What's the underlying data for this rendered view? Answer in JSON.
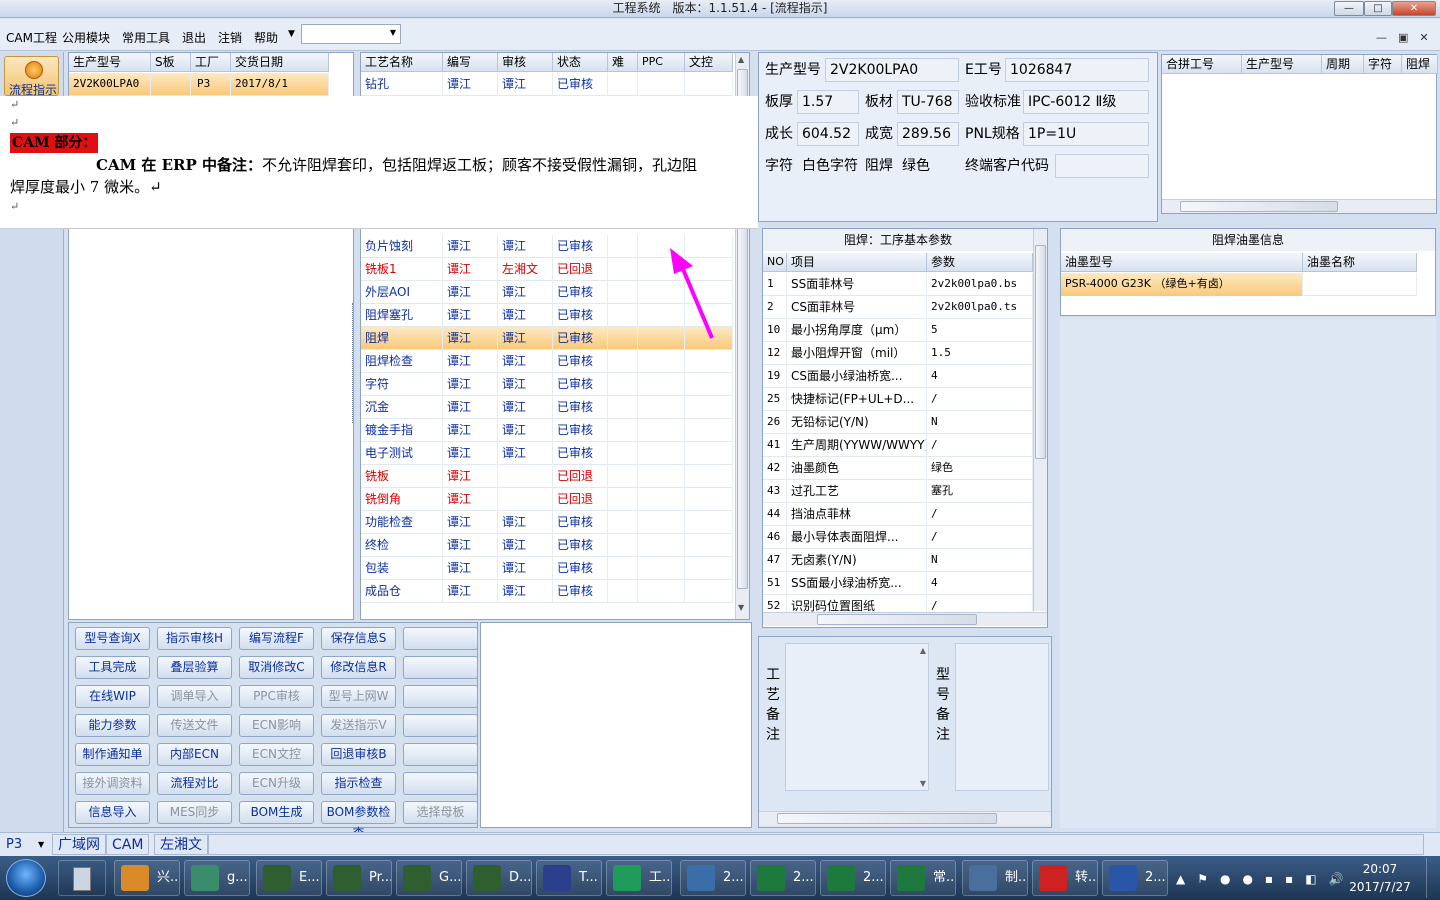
{
  "window": {
    "title": "工程系统　版本：1.1.51.4 - [流程指示]"
  },
  "menu": [
    "CAM工程",
    "公用模块",
    "常用工具",
    "退出",
    "注销",
    "帮助"
  ],
  "nav": {
    "label": "流程指示"
  },
  "order": {
    "headers": [
      "生产型号",
      "S板",
      "工厂",
      "交货日期"
    ],
    "row": [
      "2V2K00LPA0",
      "",
      "P3",
      "2017/8/1"
    ]
  },
  "process": {
    "headers": [
      "工艺名称",
      "编写",
      "审核",
      "状态",
      "难",
      "PPC",
      "文控"
    ],
    "rows": [
      {
        "name": "钻孔",
        "writer": "谭江",
        "reviewer": "谭江",
        "status": "已审核",
        "style": "normal"
      },
      {
        "name": "负片蚀刻",
        "writer": "谭江",
        "reviewer": "谭江",
        "status": "已审核",
        "style": "normal"
      },
      {
        "name": "铣板1",
        "writer": "谭江",
        "reviewer": "左湘文",
        "status": "已回退",
        "style": "red"
      },
      {
        "name": "外层AOI",
        "writer": "谭江",
        "reviewer": "谭江",
        "status": "已审核",
        "style": "normal"
      },
      {
        "name": "阻焊塞孔",
        "writer": "谭江",
        "reviewer": "谭江",
        "status": "已审核",
        "style": "normal"
      },
      {
        "name": "阻焊",
        "writer": "谭江",
        "reviewer": "谭江",
        "status": "已审核",
        "style": "selected"
      },
      {
        "name": "阻焊检查",
        "writer": "谭江",
        "reviewer": "谭江",
        "status": "已审核",
        "style": "normal"
      },
      {
        "name": "字符",
        "writer": "谭江",
        "reviewer": "谭江",
        "status": "已审核",
        "style": "normal"
      },
      {
        "name": "沉金",
        "writer": "谭江",
        "reviewer": "谭江",
        "status": "已审核",
        "style": "normal"
      },
      {
        "name": "镀金手指",
        "writer": "谭江",
        "reviewer": "谭江",
        "status": "已审核",
        "style": "normal"
      },
      {
        "name": "电子测试",
        "writer": "谭江",
        "reviewer": "谭江",
        "status": "已审核",
        "style": "normal"
      },
      {
        "name": "铣板",
        "writer": "谭江",
        "reviewer": "",
        "status": "已回退",
        "style": "red"
      },
      {
        "name": "铣倒角",
        "writer": "谭江",
        "reviewer": "",
        "status": "已回退",
        "style": "red"
      },
      {
        "name": "功能检查",
        "writer": "谭江",
        "reviewer": "谭江",
        "status": "已审核",
        "style": "normal"
      },
      {
        "name": "终检",
        "writer": "谭江",
        "reviewer": "谭江",
        "status": "已审核",
        "style": "normal"
      },
      {
        "name": "包装",
        "writer": "谭江",
        "reviewer": "谭江",
        "status": "已审核",
        "style": "normal"
      },
      {
        "name": "成品仓",
        "writer": "谭江",
        "reviewer": "谭江",
        "status": "已审核",
        "style": "normal"
      }
    ]
  },
  "note": {
    "mark1": "↵",
    "mark2": "↵",
    "label": "CAM 部分：",
    "text_bold": "CAM 在 ERP 中备注：",
    "text": "不允许阻焊套印，包括阻焊返工板；顾客不接受假性漏铜，孔边阻",
    "text2": "焊厚度最小 7 微米。↵",
    "mark3": "↵"
  },
  "info": {
    "prod_label": "生产型号",
    "prod": "2V2K00LPA0",
    "e_label": "E工号",
    "e": "1026847",
    "thick_label": "板厚",
    "thick": "1.57",
    "mat_label": "板材",
    "mat": "TU-768",
    "std_label": "验收标准",
    "std": "IPC-6012 Ⅱ级",
    "len_label": "成长",
    "len": "604.52",
    "wid_label": "成宽",
    "wid": "289.56",
    "pnl_label": "PNL规格",
    "pnl": "1P=1U",
    "char_label": "字符",
    "char": "白色字符",
    "mask_label": "阻焊",
    "mask": "绿色",
    "cust_label": "终端客户代码",
    "cust": ""
  },
  "combo_grid": {
    "headers": [
      "合拼工号",
      "生产型号",
      "周期",
      "字符",
      "阻焊"
    ]
  },
  "params": {
    "title": "阻焊：工序基本参数",
    "headers": [
      "NO",
      "项目",
      "参数"
    ],
    "rows": [
      {
        "no": "1",
        "item": "SS面菲林号",
        "val": "2v2k00lpa0.bs"
      },
      {
        "no": "2",
        "item": "CS面菲林号",
        "val": "2v2k00lpa0.ts"
      },
      {
        "no": "10",
        "item": "最小拐角厚度（μm）",
        "val": "5"
      },
      {
        "no": "12",
        "item": "最小阻焊开窗（mil）",
        "val": "1.5"
      },
      {
        "no": "19",
        "item": "CS面最小绿油桥宽...",
        "val": "4"
      },
      {
        "no": "25",
        "item": "快捷标记(FP+UL+D...",
        "val": "/"
      },
      {
        "no": "26",
        "item": "无铅标记(Y/N)",
        "val": "N"
      },
      {
        "no": "41",
        "item": "生产周期(YYWW/WWYY)",
        "val": "/"
      },
      {
        "no": "42",
        "item": "油墨颜色",
        "val": "绿色"
      },
      {
        "no": "43",
        "item": "过孔工艺",
        "val": "塞孔"
      },
      {
        "no": "44",
        "item": "挡油点菲林",
        "val": "/"
      },
      {
        "no": "46",
        "item": "最小导体表面阻焊...",
        "val": "/"
      },
      {
        "no": "47",
        "item": "无卤素(Y/N)",
        "val": "N"
      },
      {
        "no": "51",
        "item": "SS面最小绿油桥宽...",
        "val": "4"
      },
      {
        "no": "52",
        "item": "识别码位置图纸",
        "val": "/"
      }
    ]
  },
  "ink": {
    "title": "阻焊油墨信息",
    "headers": [
      "油墨型号",
      "油墨名称"
    ],
    "row": [
      "PSR-4000 G23K （绿色+有卤）",
      ""
    ]
  },
  "remarks": {
    "process": "工艺备注",
    "model": "型号备注"
  },
  "buttons": [
    [
      "型号查询X",
      "指示审核H",
      "编写流程F",
      "保存信息S",
      ""
    ],
    [
      "工具完成",
      "叠层验算",
      "取消修改C",
      "修改信息R",
      ""
    ],
    [
      "在线WIP",
      "调单导入",
      "PPC审核",
      "型号上网W",
      ""
    ],
    [
      "能力参数",
      "传送文件",
      "ECN影响",
      "发送指示V",
      ""
    ],
    [
      "制作通知单",
      "内部ECN",
      "ECN文控",
      "回退审核B",
      ""
    ],
    [
      "接外调资料",
      "流程对比",
      "ECN升级",
      "指示检查",
      ""
    ],
    [
      "信息导入",
      "MES同步",
      "BOM生成",
      "BOM参数检查",
      "选择母板"
    ]
  ],
  "buttons_disabled": [
    [
      0,
      4
    ],
    [
      1,
      4
    ],
    [
      2,
      1
    ],
    [
      2,
      2
    ],
    [
      2,
      3
    ],
    [
      2,
      4
    ],
    [
      3,
      1
    ],
    [
      3,
      2
    ],
    [
      3,
      3
    ],
    [
      3,
      4
    ],
    [
      4,
      2
    ],
    [
      4,
      4
    ],
    [
      5,
      0
    ],
    [
      5,
      2
    ],
    [
      5,
      4
    ],
    [
      6,
      1
    ],
    [
      6,
      4
    ]
  ],
  "status": {
    "plant": "P3",
    "net": "广域网",
    "module": "CAM",
    "user": "左湘文"
  },
  "taskbar": {
    "items": [
      "兴...",
      "g...",
      "E...",
      "Pr...",
      "G...",
      "D...",
      "T...",
      "工...",
      "2...",
      "2...",
      "2...",
      "常...",
      "制...",
      "转...",
      "2..."
    ],
    "time": "20:07",
    "date": "2017/7/27"
  },
  "colors": {
    "selected_row": "#f9c97a",
    "reviewer_red": "#d40000",
    "blue_text": "#0b2f9c",
    "note_label_bg": "#e01010",
    "arrow": "#ff00ff"
  }
}
